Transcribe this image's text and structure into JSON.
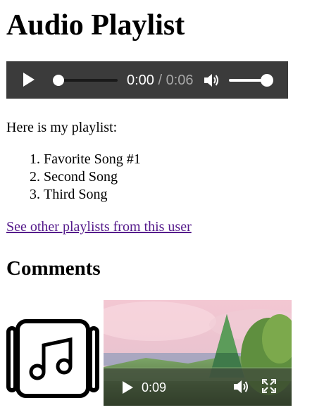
{
  "page": {
    "title": "Audio Playlist"
  },
  "audio_player": {
    "current_time": "0:00",
    "separator": " / ",
    "duration": "0:06",
    "progress": 0.0,
    "volume": 1.0,
    "icons": [
      "play-icon",
      "volume-icon"
    ]
  },
  "content": {
    "intro": "Here is my playlist:",
    "playlist": [
      "Favorite Song #1",
      "Second Song",
      "Third Song"
    ],
    "other_link": "See other playlists from this user"
  },
  "comments": {
    "title": "Comments",
    "thumbnail_icon": "music-note-icon",
    "video_player": {
      "current_time": "0:09",
      "icons": [
        "play-icon",
        "volume-icon",
        "fullscreen-icon"
      ]
    }
  },
  "colors": {
    "player_bg": "#3b3b3b",
    "link_visited": "#551a8b",
    "time_muted": "#a8a8a8"
  }
}
